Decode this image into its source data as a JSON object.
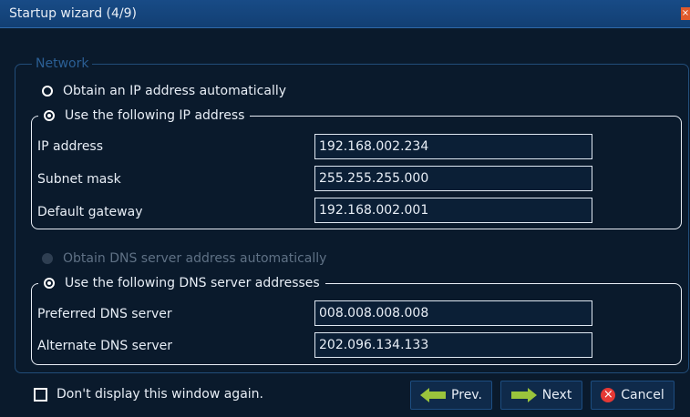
{
  "window": {
    "title": "Startup wizard (4/9)",
    "close_glyph": "×"
  },
  "network": {
    "legend": "Network",
    "ip_auto_label": "Obtain an IP address automatically",
    "ip_manual_label": "Use the following IP address",
    "fields": [
      {
        "label": "IP address",
        "value": "192.168.002.234"
      },
      {
        "label": "Subnet mask",
        "value": "255.255.255.000"
      },
      {
        "label": "Default gateway",
        "value": "192.168.002.001"
      }
    ],
    "dns_auto_label": "Obtain DNS server address automatically",
    "dns_manual_label": "Use the following DNS server addresses",
    "dns_fields": [
      {
        "label": "Preferred DNS server",
        "value": "008.008.008.008"
      },
      {
        "label": "Alternate DNS server",
        "value": "202.096.134.133"
      }
    ]
  },
  "footer": {
    "dont_display_label": "Don't display this window again.",
    "prev_label": "Prev.",
    "next_label": "Next",
    "cancel_label": "Cancel"
  },
  "colors": {
    "title_bar": "#184b86",
    "background": "#0a1a2c",
    "frame": "#224d79",
    "cancel_red": "#e53935",
    "arrow_green": "#9ac43c"
  },
  "icons": {
    "radio": "radio-icon",
    "checkbox": "checkbox-icon",
    "prev": "arrow-left-icon",
    "next": "arrow-right-icon",
    "cancel": "cancel-icon",
    "close": "close-icon"
  }
}
